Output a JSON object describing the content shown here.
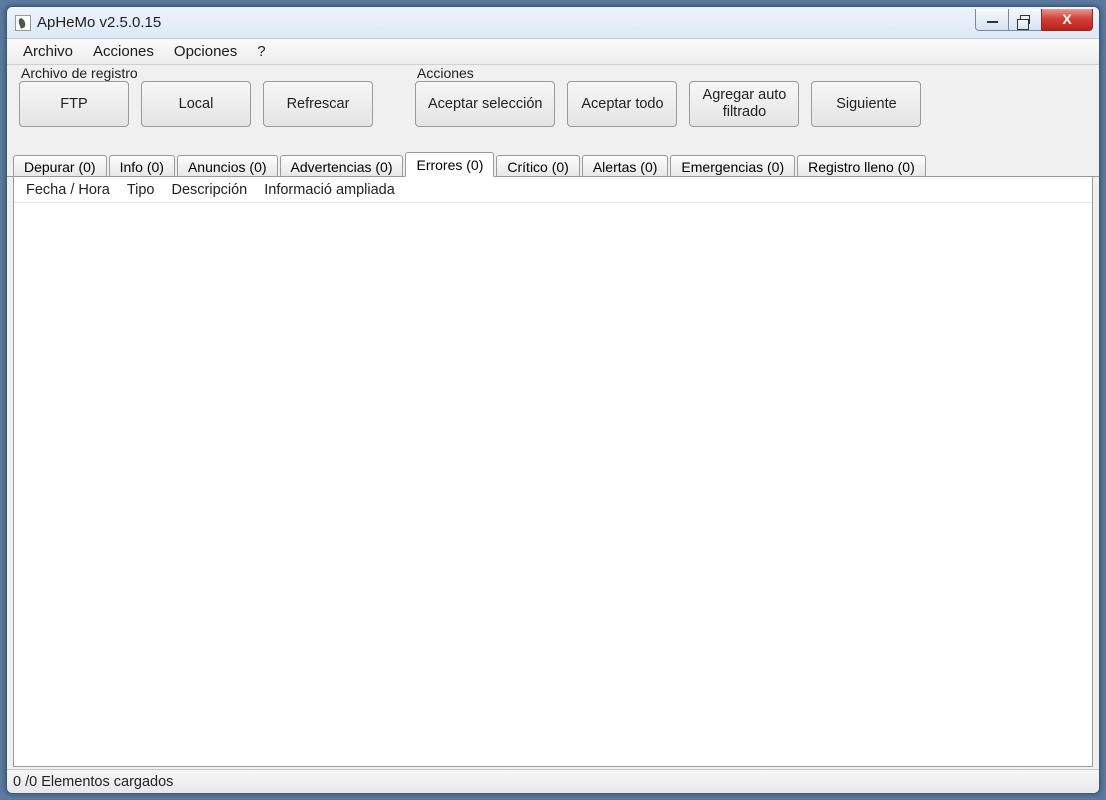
{
  "window": {
    "title": "ApHeMo v2.5.0.15"
  },
  "menu": {
    "archivo": "Archivo",
    "acciones": "Acciones",
    "opciones": "Opciones",
    "help": "?"
  },
  "groups": {
    "log": {
      "legend": "Archivo de registro",
      "ftp": "FTP",
      "local": "Local",
      "refresh": "Refrescar"
    },
    "actions": {
      "legend": "Acciones",
      "accept_selection": "Aceptar selección",
      "accept_all": "Aceptar todo",
      "add_auto_filtered": "Agregar auto\nfiltrado",
      "next": "Siguiente"
    }
  },
  "tabs": {
    "items": [
      {
        "label": "Depurar (0)",
        "active": false
      },
      {
        "label": "Info (0)",
        "active": false
      },
      {
        "label": "Anuncios (0)",
        "active": false
      },
      {
        "label": "Advertencias (0)",
        "active": false
      },
      {
        "label": "Errores (0)",
        "active": true
      },
      {
        "label": "Crítico (0)",
        "active": false
      },
      {
        "label": "Alertas (0)",
        "active": false
      },
      {
        "label": "Emergencias (0)",
        "active": false
      },
      {
        "label": "Registro lleno (0)",
        "active": false
      }
    ]
  },
  "columns": {
    "c0": "Fecha / Hora",
    "c1": "Tipo",
    "c2": "Descripción",
    "c3": "Informació ampliada"
  },
  "status": {
    "text": "0 /0 Elementos cargados"
  }
}
